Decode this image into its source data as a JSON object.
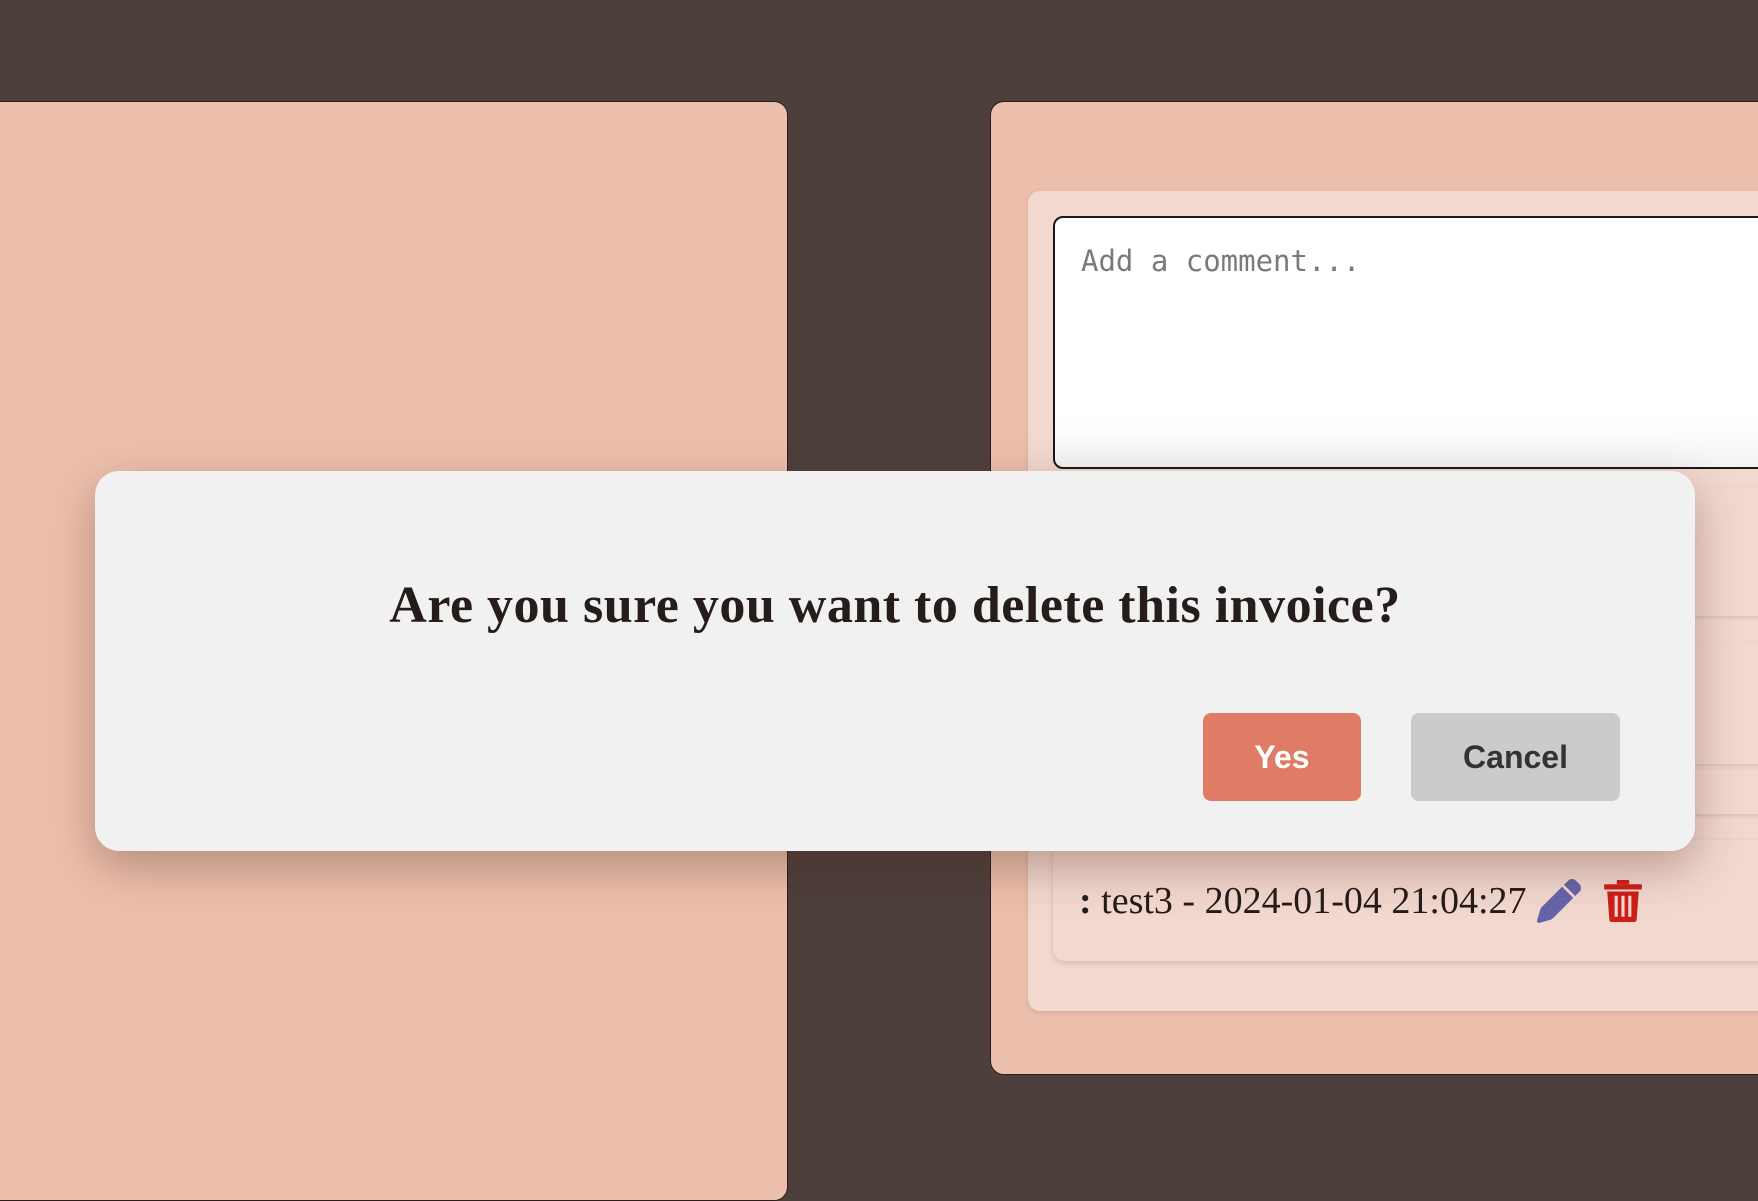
{
  "comments": {
    "input_placeholder": "Add a comment...",
    "items": [
      {
        "prefix": ":",
        "text": "test3 - 2024-01-04 21:04:27",
        "edit_icon": "pencil-icon",
        "delete_icon": "trash-icon"
      }
    ]
  },
  "dialog": {
    "message": "Are you sure you want to delete this invoice?",
    "confirm_label": "Yes",
    "cancel_label": "Cancel"
  },
  "colors": {
    "background": "#4d3f3c",
    "panel": "#edc0ad",
    "card": "#f2d8cf",
    "dialog_bg": "#f1f1f1",
    "confirm_button": "#e07c66",
    "cancel_button": "#cbcbcb",
    "edit_icon": "#6664a8",
    "delete_icon": "#cc1f17"
  }
}
